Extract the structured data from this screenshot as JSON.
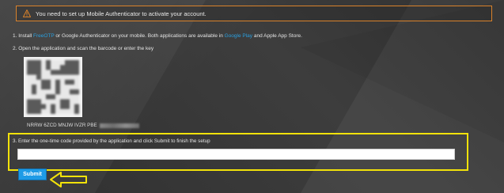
{
  "alert": {
    "icon": "warning-icon",
    "message": "You need to set up Mobile Authenticator to activate your account."
  },
  "steps": {
    "step1": {
      "prefix": "1. Install ",
      "app_link": "FreeOTP",
      "middle": " or Google Authenticator on your mobile. Both applications are available in ",
      "store_link": "Google Play",
      "suffix": " and Apple App Store."
    },
    "step2": "2. Open the application and scan the barcode or enter the key",
    "key_visible": "NRRW 6ZCD MNJW IVZR PBE",
    "step3": "3. Enter the one-time code provided by the application and click Submit to finish the setup"
  },
  "form": {
    "code_placeholder": "",
    "submit_label": "Submit"
  },
  "colors": {
    "alert_border": "#d9822b",
    "link": "#2aa0e0",
    "highlight": "#f2e20a",
    "submit_bg": "#1e9be6"
  }
}
